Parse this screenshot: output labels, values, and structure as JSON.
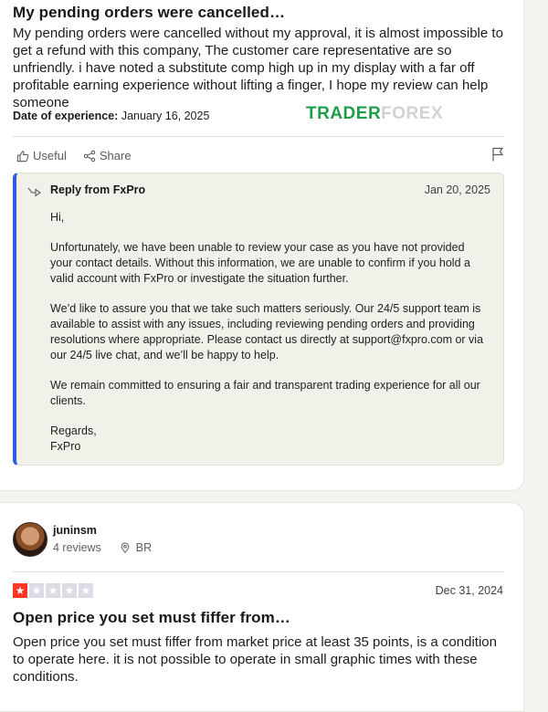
{
  "review1": {
    "title": "My pending orders were cancelled…",
    "body": "My pending orders were cancelled without my approval, it is almost impossible to get a refund with this company, The customer care representative are so unfriendly. i have noted a substitute comp high up in my display with a far off profitable earning experience without lifting a finger, I hope my review can help someone",
    "date_label": "Date of experience:",
    "date_value": "January 16, 2025",
    "useful_label": "Useful",
    "share_label": "Share",
    "reply": {
      "title": "Reply from FxPro",
      "date": "Jan 20, 2025",
      "paragraphs": [
        "Hi,",
        "Unfortunately, we have been unable to review your case as you have not provided your contact details. Without this information, we are unable to confirm if you hold a valid account with FxPro or investigate the situation further.",
        "We’d like to assure you that we take such matters seriously. Our 24/5 support team is available to assist with any issues, including reviewing pending orders and providing resolutions where appropriate. Please contact us directly at support@fxpro.com or via our 24/5 live chat, and we’ll be happy to help.",
        "We remain committed to ensuring a fair and transparent trading experience for all our clients."
      ],
      "closing": "Regards,",
      "signature": "FxPro"
    }
  },
  "watermark": {
    "part1": "TRADER",
    "part2": "FOREX"
  },
  "review2": {
    "username": "juninsm",
    "reviews_count": "4 reviews",
    "country": "BR",
    "rating": 1,
    "max_rating": 5,
    "date": "Dec 31, 2024",
    "title": "Open price you set must fiffer from…",
    "body": "Open price you set must fiffer from market price at least 35 points, is a condition to operate here. it is not possible to operate in small graphic times with these conditions."
  },
  "colors": {
    "reply_accent": "#2f5be0",
    "star_active": "#ff3722",
    "star_inactive": "#dcdce6",
    "watermark_green": "#1e9e4a"
  },
  "icons": [
    "thumbs-up-icon",
    "share-icon",
    "flag-icon",
    "reply-arrow-icon",
    "location-pin-icon",
    "star-icon"
  ]
}
